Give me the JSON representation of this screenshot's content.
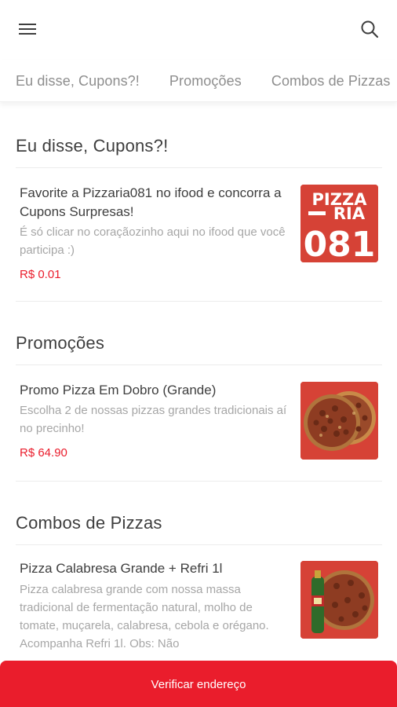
{
  "tabs": [
    "Eu disse, Cupons?!",
    "Promoções",
    "Combos de Pizzas"
  ],
  "sections": [
    {
      "title": "Eu disse, Cupons?!",
      "item": {
        "name": "Favorite a Pizzaria081 no ifood e concorra a Cupons Surpresas!",
        "description": "É só clicar no coraçãozinho aqui no ifood que você participa :)",
        "price": "R$ 0.01",
        "logo_lines": [
          "PIZZA",
          "RIA",
          "081"
        ]
      }
    },
    {
      "title": "Promoções",
      "item": {
        "name": "Promo Pizza Em Dobro (Grande)",
        "description": "Escolha 2 de nossas pizzas grandes tradicionais aí no precinho!",
        "price": "R$ 64.90"
      }
    },
    {
      "title": "Combos de Pizzas",
      "item": {
        "name": "Pizza Calabresa Grande + Refri 1l",
        "description": "Pizza calabresa grande com nossa massa tradicional de fermentação natural, molho de tomate, muçarela, calabresa, cebola e orégano. Acompanha Refri 1l. Obs: Não"
      }
    }
  ],
  "cta": "Verificar endereço",
  "colors": {
    "brand": "#ea1d2c",
    "logo_bg": "#d64236"
  },
  "icons": {
    "menu": "menu-icon",
    "search": "search-icon"
  }
}
